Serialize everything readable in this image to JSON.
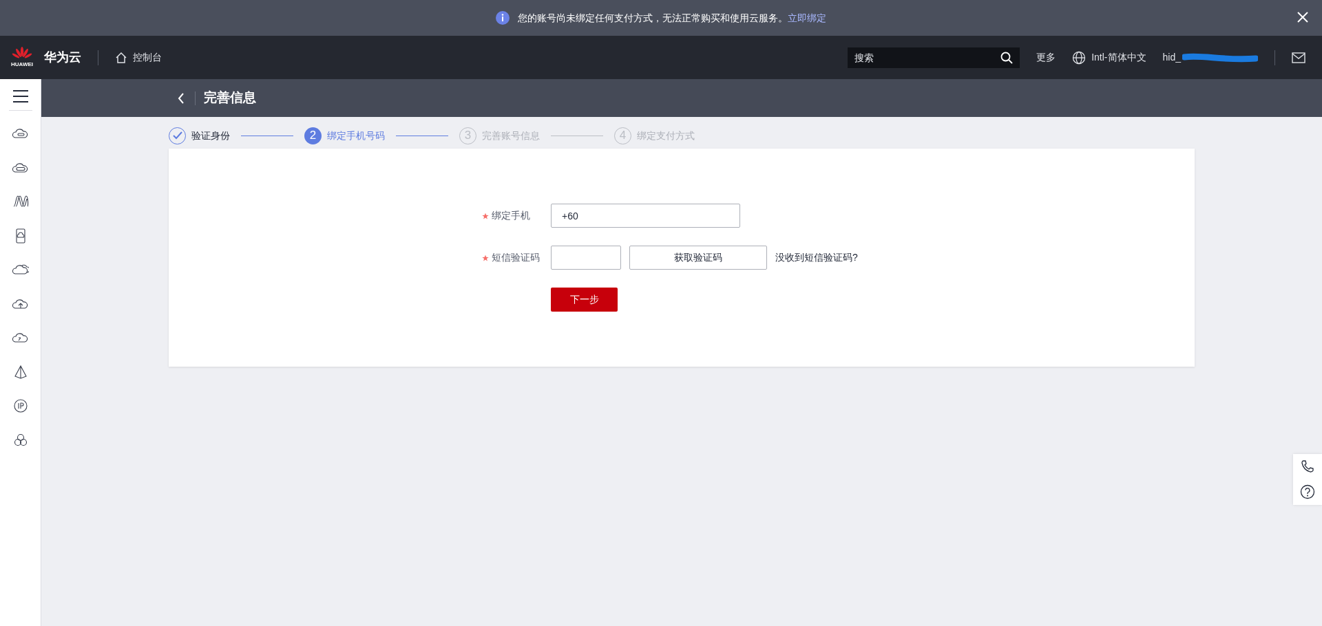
{
  "notice": {
    "text": "您的账号尚未绑定任何支付方式，无法正常购买和使用云服务。",
    "link": "立即绑定"
  },
  "header": {
    "logo_text": "HUAWEI",
    "brand": "华为云",
    "console": "控制台",
    "search": {
      "placeholder": "搜索"
    },
    "more": "更多",
    "language": "Intl-简体中文",
    "user": "hid_"
  },
  "page_title": "完善信息",
  "steps": [
    {
      "label": "验证身份",
      "completed": true,
      "selected": false
    },
    {
      "number": "2",
      "label": "绑定手机号码",
      "completed": false,
      "selected": true
    },
    {
      "number": "3",
      "label": "完善账号信息",
      "completed": false,
      "selected": false
    },
    {
      "number": "4",
      "label": "绑定支付方式",
      "completed": false,
      "selected": false
    }
  ],
  "form": {
    "phone": {
      "label": "绑定手机",
      "required": true,
      "value": "+60"
    },
    "sms": {
      "label": "短信验证码",
      "required": true,
      "button": "获取验证码",
      "help_link": "没收到短信验证码?"
    },
    "next_button": "下一步"
  }
}
